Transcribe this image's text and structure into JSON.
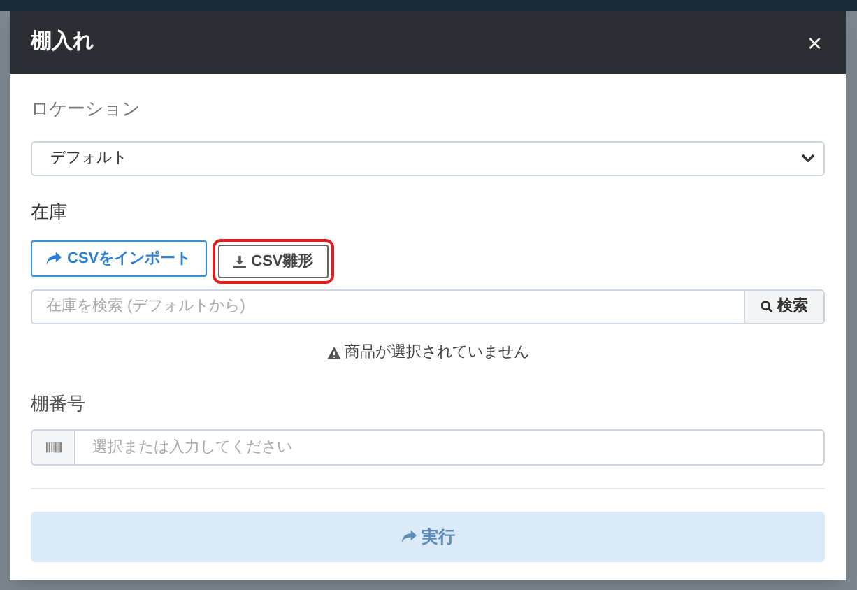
{
  "modal": {
    "title": "棚入れ",
    "close": "×"
  },
  "location": {
    "label": "ロケーション",
    "value": "デフォルト"
  },
  "stock": {
    "label": "在庫",
    "buttons": [
      {
        "kind": "import",
        "label": "CSVをインポート",
        "highlighted": false
      },
      {
        "kind": "template",
        "label": "CSV雛形",
        "highlighted": true
      }
    ],
    "search": {
      "placeholder": "在庫を検索 (デフォルトから)",
      "button": "検索"
    },
    "warning": "商品が選択されていません"
  },
  "shelf": {
    "label": "棚番号",
    "placeholder": "選択または入力してください"
  },
  "submit": {
    "label": "実行",
    "disabled": true
  }
}
